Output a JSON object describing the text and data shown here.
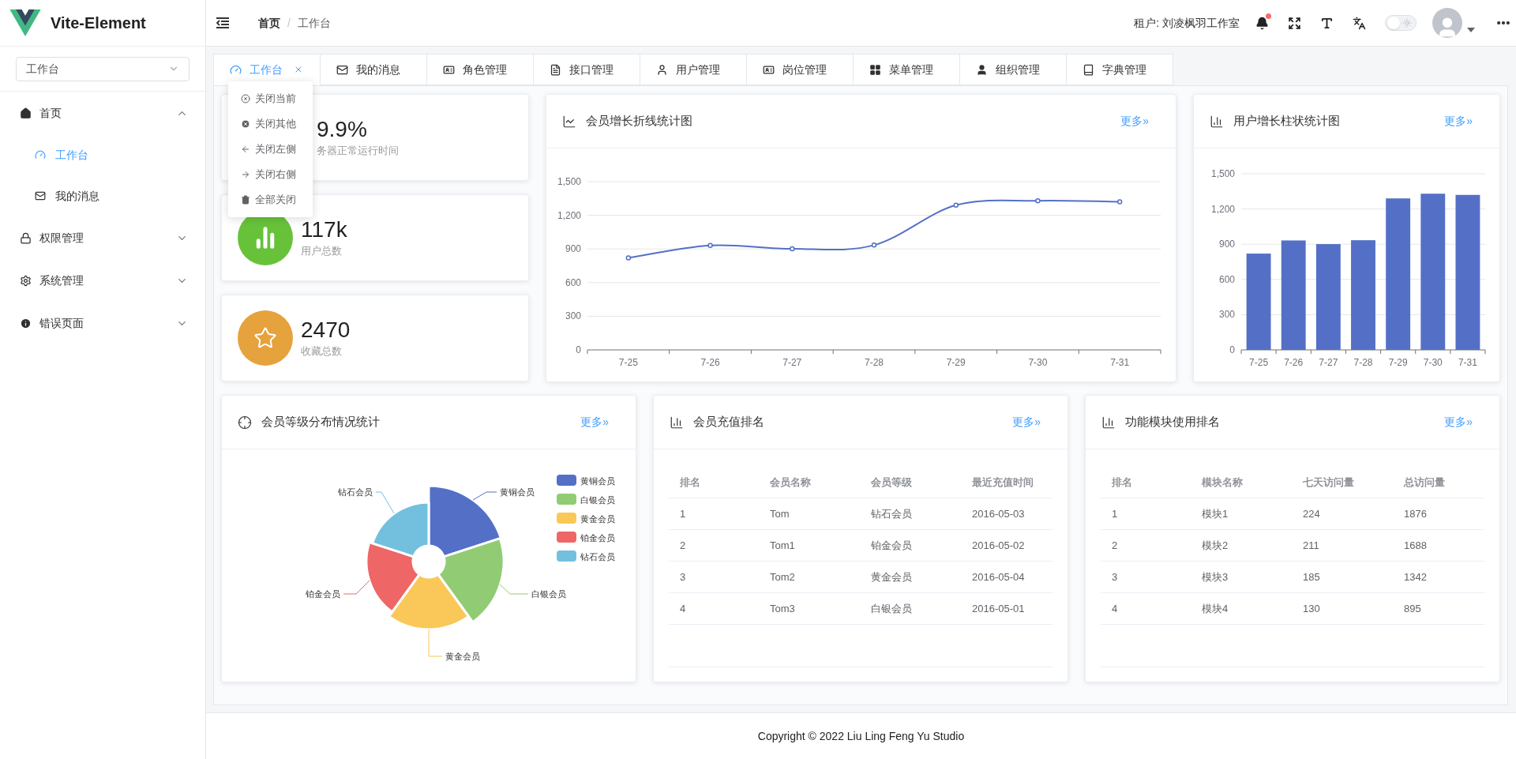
{
  "logo": {
    "title": "Vite-Element"
  },
  "sidebar": {
    "select": {
      "value": "工作台"
    },
    "items": [
      {
        "label": "首页",
        "expanded": true,
        "children": [
          {
            "label": "工作台",
            "selected": true
          },
          {
            "label": "我的消息",
            "selected": false
          }
        ]
      },
      {
        "label": "权限管理",
        "expanded": false
      },
      {
        "label": "系统管理",
        "expanded": false
      },
      {
        "label": "错误页面",
        "expanded": false
      }
    ]
  },
  "header": {
    "breadcrumb": [
      "首页",
      "工作台"
    ],
    "breadcrumb_separator": "/",
    "tenant": "租户: 刘凌枫羽工作室",
    "notification_dot": true,
    "theme_switch": {
      "on": false
    }
  },
  "tabs": [
    {
      "label": "工作台",
      "selected": true
    },
    {
      "label": "我的消息",
      "selected": false
    },
    {
      "label": "角色管理",
      "selected": false
    },
    {
      "label": "接口管理",
      "selected": false
    },
    {
      "label": "用户管理",
      "selected": false
    },
    {
      "label": "岗位管理",
      "selected": false
    },
    {
      "label": "菜单管理",
      "selected": false
    },
    {
      "label": "组织管理",
      "selected": false
    },
    {
      "label": "字典管理",
      "selected": false
    }
  ],
  "tab_menu": [
    "关闭当前",
    "关闭其他",
    "关闭左侧",
    "关闭右侧",
    "全部关闭"
  ],
  "stats": [
    {
      "value": "9.9%",
      "label": "务器正常运行时间"
    },
    {
      "value": "117k",
      "label": "用户总数",
      "color": "#67c23a"
    },
    {
      "value": "2470",
      "label": "收藏总数",
      "color": "#e6a23c"
    }
  ],
  "line_card": {
    "title": "会员增长折线统计图",
    "more": "更多»",
    "chart_data": {
      "type": "line",
      "categories": [
        "7-25",
        "7-26",
        "7-27",
        "7-28",
        "7-29",
        "7-30",
        "7-31"
      ],
      "grid": true,
      "series": [
        {
          "color": "#5470c6",
          "marker": "circle",
          "values": [
            820,
            932,
            901,
            934,
            1290,
            1330,
            1320
          ]
        }
      ],
      "ylim": [
        0,
        1500
      ],
      "yticks": [
        0,
        {
          "value": 300,
          "label": "300"
        },
        {
          "value": 600,
          "label": "600"
        },
        {
          "value": 900,
          "label": "900"
        },
        {
          "value": 1200,
          "label": "1,200"
        },
        {
          "value": 1500,
          "label": "1,500"
        }
      ]
    }
  },
  "bar_card": {
    "title": "用户增长柱状统计图",
    "more": "更多»",
    "chart_data": {
      "type": "bar",
      "categories": [
        "7-25",
        "7-26",
        "7-27",
        "7-28",
        "7-29",
        "7-30",
        "7-31"
      ],
      "grid": true,
      "series": [
        {
          "color": "#5470c6",
          "values": [
            820,
            932,
            901,
            934,
            1290,
            1330,
            1320
          ]
        }
      ],
      "ylim": [
        0,
        1500
      ],
      "yticks": [
        0,
        {
          "value": 300,
          "label": "300"
        },
        {
          "value": 600,
          "label": "600"
        },
        {
          "value": 900,
          "label": "900"
        },
        {
          "value": 1200,
          "label": "1,200"
        },
        {
          "value": 1500,
          "label": "1,500"
        }
      ]
    }
  },
  "pie_card": {
    "title": "会员等级分布情况统计",
    "more": "更多»",
    "slices": [
      {
        "label": "黄铜会员",
        "color": "#5470c6"
      },
      {
        "label": "白银会员",
        "color": "#91cc75"
      },
      {
        "label": "黄金会员",
        "color": "#fac858"
      },
      {
        "label": "铂金会员",
        "color": "#ee6666"
      },
      {
        "label": "钻石会员",
        "color": "#73c0de"
      }
    ],
    "legend": [
      {
        "label": "黄铜会员",
        "color": "#5470c6"
      },
      {
        "label": "白银会员",
        "color": "#91cc75"
      },
      {
        "label": "黄金会员",
        "color": "#fac858"
      },
      {
        "label": "铂金会员",
        "color": "#ee6666"
      },
      {
        "label": "钻石会员",
        "color": "#73c0de"
      }
    ]
  },
  "tables": [
    {
      "title": "会员充值排名",
      "more": "更多»",
      "columns": [
        "排名",
        "会员名称",
        "会员等级",
        "最近充值时间"
      ],
      "rows": [
        [
          "1",
          "Tom",
          "钻石会员",
          "2016-05-03"
        ],
        [
          "2",
          "Tom1",
          "铂金会员",
          "2016-05-02"
        ],
        [
          "3",
          "Tom2",
          "黄金会员",
          "2016-05-04"
        ],
        [
          "4",
          "Tom3",
          "白银会员",
          "2016-05-01"
        ]
      ]
    },
    {
      "title": "功能模块使用排名",
      "more": "更多»",
      "columns": [
        "排名",
        "模块名称",
        "七天访问量",
        "总访问量"
      ],
      "rows": [
        [
          "1",
          "模块1",
          "224",
          "1876"
        ],
        [
          "2",
          "模块2",
          "211",
          "1688"
        ],
        [
          "3",
          "模块3",
          "185",
          "1342"
        ],
        [
          "4",
          "模块4",
          "130",
          "895"
        ]
      ]
    }
  ],
  "footer": "Copyright © 2022 Liu Ling Feng Yu Studio"
}
